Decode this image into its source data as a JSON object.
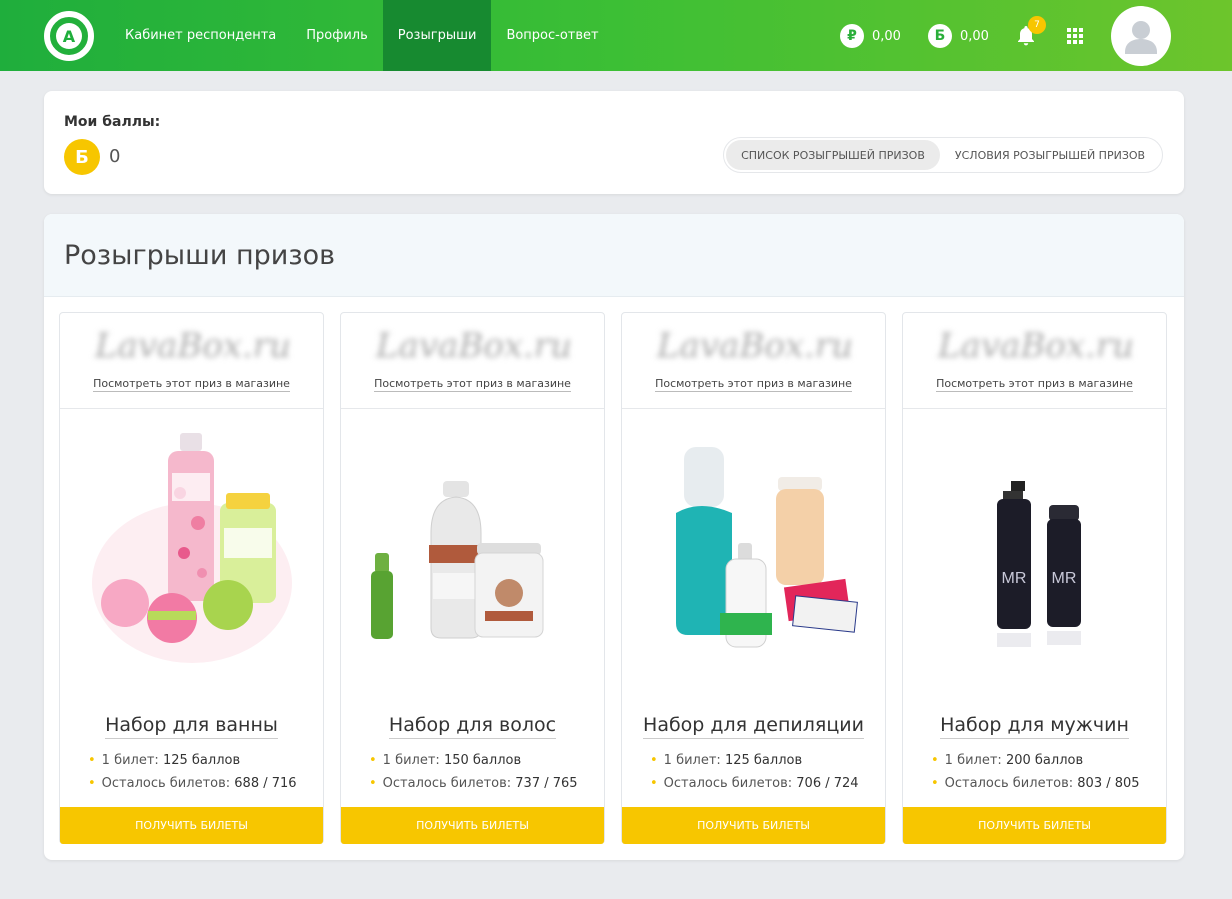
{
  "nav": {
    "logo_letter": "A",
    "items": [
      {
        "label": "Кабинет респондента",
        "active": false
      },
      {
        "label": "Профиль",
        "active": false
      },
      {
        "label": "Розыгрыши",
        "active": true
      },
      {
        "label": "Вопрос-ответ",
        "active": false
      }
    ]
  },
  "header": {
    "rub_symbol": "₽",
    "rub_balance": "0,00",
    "bonus_symbol": "Б",
    "bonus_balance": "0,00",
    "notifications_count": "7"
  },
  "points": {
    "title": "Мои баллы:",
    "coin_symbol": "Б",
    "value": "0",
    "tabs": [
      {
        "label": "СПИСОК РОЗЫГРЫШЕЙ ПРИЗОВ",
        "active": true
      },
      {
        "label": "УСЛОВИЯ РОЗЫГРЫШЕЙ ПРИЗОВ",
        "active": false
      }
    ]
  },
  "prizes": {
    "title": "Розыгрыши призов",
    "items": [
      {
        "shop_logo": "LavaBox.ru",
        "shop_link": "Посмотреть этот приз в магазине",
        "name": "Набор для ванны",
        "ticket_label": "1 билет:",
        "ticket_price": "125 баллов",
        "left_label": "Осталось билетов:",
        "left_value": "688 / 716",
        "button": "ПОЛУЧИТЬ БИЛЕТЫ"
      },
      {
        "shop_logo": "LavaBox.ru",
        "shop_link": "Посмотреть этот приз в магазине",
        "name": "Набор для волос",
        "ticket_label": "1 билет:",
        "ticket_price": "150 баллов",
        "left_label": "Осталось билетов:",
        "left_value": "737 / 765",
        "button": "ПОЛУЧИТЬ БИЛЕТЫ"
      },
      {
        "shop_logo": "LavaBox.ru",
        "shop_link": "Посмотреть этот приз в магазине",
        "name": "Набор для депиляции",
        "ticket_label": "1 билет:",
        "ticket_price": "125 баллов",
        "left_label": "Осталось билетов:",
        "left_value": "706 / 724",
        "button": "ПОЛУЧИТЬ БИЛЕТЫ"
      },
      {
        "shop_logo": "LavaBox.ru",
        "shop_link": "Посмотреть этот приз в магазине",
        "name": "Набор для мужчин",
        "ticket_label": "1 билет:",
        "ticket_price": "200 баллов",
        "left_label": "Осталось билетов:",
        "left_value": "803 / 805",
        "button": "ПОЛУЧИТЬ БИЛЕТЫ"
      }
    ]
  },
  "colors": {
    "header_green_start": "#1fae3c",
    "header_green_end": "#6dc52c",
    "nav_active": "#178a30",
    "accent_yellow": "#f7c600"
  }
}
